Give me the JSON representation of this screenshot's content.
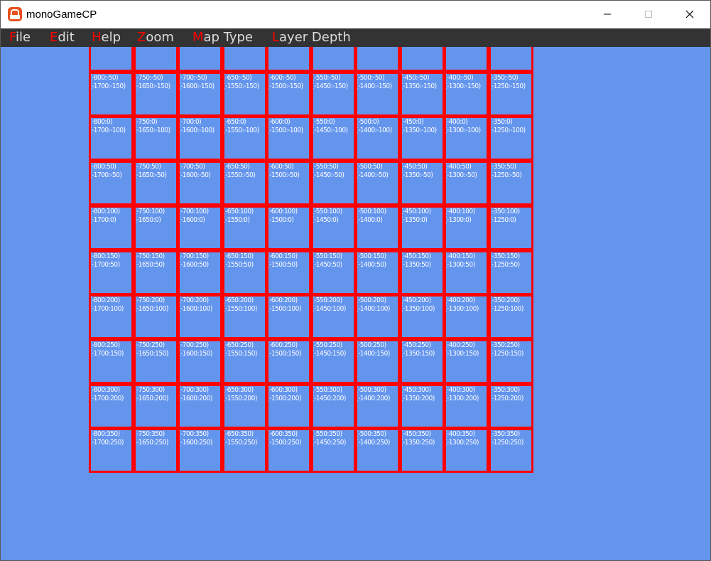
{
  "window": {
    "title": "monoGameCP",
    "controls": [
      "minimize",
      "maximize",
      "close"
    ]
  },
  "menu": {
    "items": [
      {
        "accel": "F",
        "rest": "ile"
      },
      {
        "accel": "E",
        "rest": "dit"
      },
      {
        "accel": "H",
        "rest": "elp"
      },
      {
        "accel": "Z",
        "rest": "oom"
      },
      {
        "accel": "M",
        "rest": "ap Type"
      },
      {
        "accel": "L",
        "rest": "ayer Depth"
      }
    ]
  },
  "colors": {
    "background": "#6495ed",
    "tile_border": "#ff0000",
    "tile_text": "#ffffff",
    "menubar": "#333333",
    "menu_text": "#dddddd",
    "menu_accel": "#ff0000"
  },
  "map": {
    "columns": [
      -800,
      -750,
      -700,
      -650,
      -600,
      -550,
      -500,
      -450,
      -400,
      -350
    ],
    "rows": [
      -100,
      -50,
      0,
      50,
      100,
      150,
      200,
      250,
      300,
      350
    ],
    "tiles": [
      [
        "",
        "",
        "",
        "",
        "",
        "",
        "",
        "",
        "",
        ""
      ],
      [
        "(-800:-50)|(-1700:-150)",
        "(-750:-50)|(-1650:-150)",
        "(-700:-50)|(-1600:-150)",
        "(-650:-50)|(-1550:-150)",
        "(-600:-50)|(-1500:-150)",
        "(-550:-50)|(-1450:-150)",
        "(-500:-50)|(-1400:-150)",
        "(-450:-50)|(-1350:-150)",
        "(-400:-50)|(-1300:-150)",
        "(-350:-50)|(-1250:-150)"
      ],
      [
        "(-800:0)|(-1700:-100)",
        "(-750:0)|(-1650:-100)",
        "(-700:0)|(-1600:-100)",
        "(-650:0)|(-1550:-100)",
        "(-600:0)|(-1500:-100)",
        "(-550:0)|(-1450:-100)",
        "(-500:0)|(-1400:-100)",
        "(-450:0)|(-1350:-100)",
        "(-400:0)|(-1300:-100)",
        "(-350:0)|(-1250:-100)"
      ],
      [
        "(-800:50)|(-1700:-50)",
        "(-750:50)|(-1650:-50)",
        "(-700:50)|(-1600:-50)",
        "(-650:50)|(-1550:-50)",
        "(-600:50)|(-1500:-50)",
        "(-550:50)|(-1450:-50)",
        "(-500:50)|(-1400:-50)",
        "(-450:50)|(-1350:-50)",
        "(-400:50)|(-1300:-50)",
        "(-350:50)|(-1250:-50)"
      ],
      [
        "(-800:100)|(-1700:0)",
        "(-750:100)|(-1650:0)",
        "(-700:100)|(-1600:0)",
        "(-650:100)|(-1550:0)",
        "(-600:100)|(-1500:0)",
        "(-550:100)|(-1450:0)",
        "(-500:100)|(-1400:0)",
        "(-450:100)|(-1350:0)",
        "(-400:100)|(-1300:0)",
        "(-350:100)|(-1250:0)"
      ],
      [
        "(-800:150)|(-1700:50)",
        "(-750:150)|(-1650:50)",
        "(-700:150)|(-1600:50)",
        "(-650:150)|(-1550:50)",
        "(-600:150)|(-1500:50)",
        "(-550:150)|(-1450:50)",
        "(-500:150)|(-1400:50)",
        "(-450:150)|(-1350:50)",
        "(-400:150)|(-1300:50)",
        "(-350:150)|(-1250:50)"
      ],
      [
        "(-800:200)|(-1700:100)",
        "(-750:200)|(-1650:100)",
        "(-700:200)|(-1600:100)",
        "(-650:200)|(-1550:100)",
        "(-600:200)|(-1500:100)",
        "(-550:200)|(-1450:100)",
        "(-500:200)|(-1400:100)",
        "(-450:200)|(-1350:100)",
        "(-400:200)|(-1300:100)",
        "(-350:200)|(-1250:100)"
      ],
      [
        "(-800:250)|(-1700:150)",
        "(-750:250)|(-1650:150)",
        "(-700:250)|(-1600:150)",
        "(-650:250)|(-1550:150)",
        "(-600:250)|(-1500:150)",
        "(-550:250)|(-1450:150)",
        "(-500:250)|(-1400:150)",
        "(-450:250)|(-1350:150)",
        "(-400:250)|(-1300:150)",
        "(-350:250)|(-1250:150)"
      ],
      [
        "(-800:300)|(-1700:200)",
        "(-750:300)|(-1650:200)",
        "(-700:300)|(-1600:200)",
        "(-650:300)|(-1550:200)",
        "(-600:300)|(-1500:200)",
        "(-550:300)|(-1450:200)",
        "(-500:300)|(-1400:200)",
        "(-450:300)|(-1350:200)",
        "(-400:300)|(-1300:200)",
        "(-350:300)|(-1250:200)"
      ],
      [
        "(-800:350)|(-1700:250)",
        "(-750:350)|(-1650:250)",
        "(-700:350)|(-1600:250)",
        "(-650:350)|(-1550:250)",
        "(-600:350)|(-1500:250)",
        "(-550:350)|(-1450:250)",
        "(-500:350)|(-1400:250)",
        "(-450:350)|(-1350:250)",
        "(-400:350)|(-1300:250)",
        "(-350:350)|(-1250:250)"
      ]
    ]
  }
}
